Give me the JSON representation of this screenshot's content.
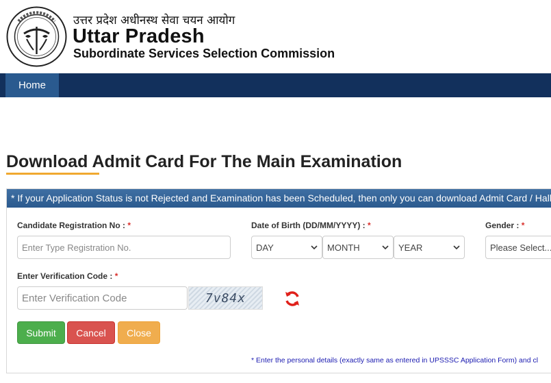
{
  "header": {
    "hindi_title": "उत्तर प्रदेश अधीनस्थ सेवा चयन आयोग",
    "title": "Uttar Pradesh",
    "subtitle": "Subordinate Services Selection Commission"
  },
  "nav": {
    "home_label": "Home"
  },
  "page": {
    "title": "Download Admit Card For The Main Examination"
  },
  "notice": "* If your Application Status is not Rejected and Examination has been Scheduled, then only you can download Admit Card / Hall",
  "form": {
    "registration": {
      "label": "Candidate Registration No :",
      "required": "*",
      "placeholder": "Enter Type Registration No."
    },
    "dob": {
      "label": "Date of Birth (DD/MM/YYYY) :",
      "required": "*",
      "day": "DAY",
      "month": "MONTH",
      "year": "YEAR"
    },
    "gender": {
      "label": "Gender :",
      "required": "*",
      "selected": "Please Select..."
    },
    "verification": {
      "label": "Enter Verification Code :",
      "required": "*",
      "placeholder": "Enter Verification Code",
      "captcha_text": "7v84x"
    },
    "buttons": {
      "submit": "Submit",
      "cancel": "Cancel",
      "close": "Close"
    },
    "note": "* Enter the personal details (exactly same as entered in UPSSSC Application Form) and cl"
  },
  "colors": {
    "navbar": "#12305c",
    "nav_active": "#2a5a8f",
    "notice_bar": "#2b5a8e",
    "accent_underline": "#f0a830",
    "submit": "#4cae4c",
    "cancel": "#d9534f",
    "close": "#f0ad4e",
    "required": "#d9302c",
    "note_text": "#1a1ab0"
  },
  "icons": {
    "emblem": "up-state-emblem-icon",
    "refresh": "refresh-icon",
    "dropdown": "chevron-down-icon"
  }
}
